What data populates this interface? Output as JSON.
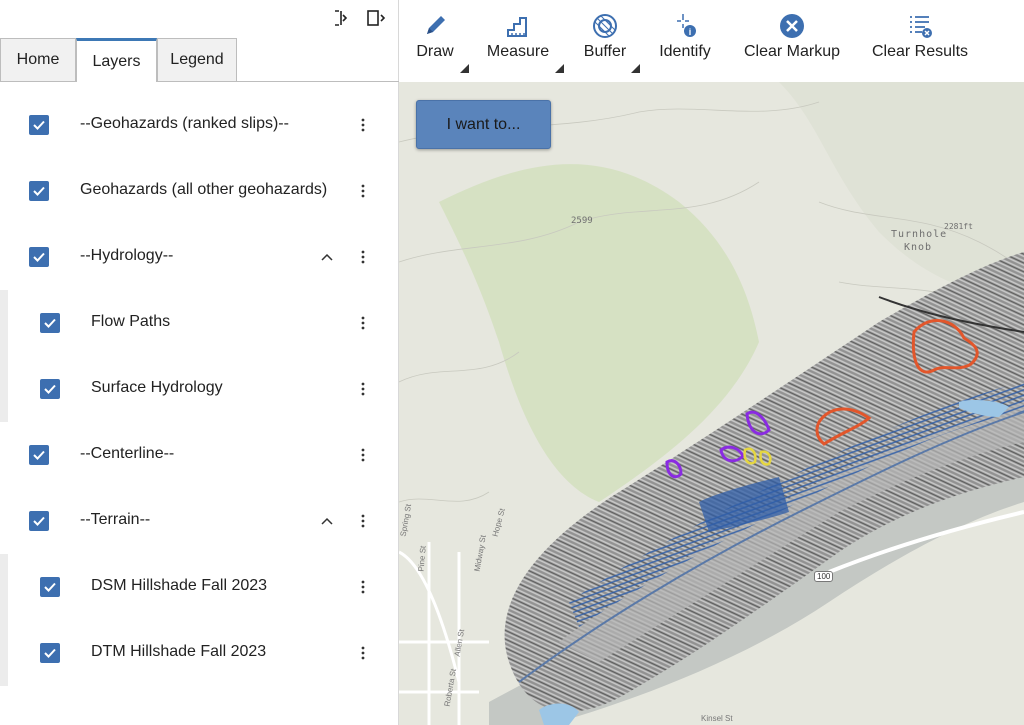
{
  "panel": {
    "tabs": [
      {
        "label": "Home"
      },
      {
        "label": "Layers"
      },
      {
        "label": "Legend"
      }
    ],
    "active_tab": "Layers",
    "layers": [
      {
        "label": "--Geohazards (ranked slips)--",
        "checked": true,
        "expandable": false,
        "child": false
      },
      {
        "label": "Geohazards (all other geohazards)",
        "checked": true,
        "expandable": false,
        "child": false
      },
      {
        "label": "--Hydrology--",
        "checked": true,
        "expandable": true,
        "expanded": true,
        "child": false
      },
      {
        "label": "Flow Paths",
        "checked": true,
        "expandable": false,
        "child": true
      },
      {
        "label": "Surface Hydrology",
        "checked": true,
        "expandable": false,
        "child": true
      },
      {
        "label": "--Centerline--",
        "checked": true,
        "expandable": false,
        "child": false
      },
      {
        "label": "--Terrain--",
        "checked": true,
        "expandable": true,
        "expanded": true,
        "child": false
      },
      {
        "label": "DSM Hillshade Fall 2023",
        "checked": true,
        "expandable": false,
        "child": true
      },
      {
        "label": "DTM Hillshade Fall 2023",
        "checked": true,
        "expandable": false,
        "child": true
      }
    ]
  },
  "toolbar": {
    "tools": [
      {
        "label": "Draw",
        "icon": "pencil-icon",
        "dropdown": true
      },
      {
        "label": "Measure",
        "icon": "ruler-icon",
        "dropdown": true
      },
      {
        "label": "Buffer",
        "icon": "buffer-icon",
        "dropdown": true
      },
      {
        "label": "Identify",
        "icon": "identify-icon",
        "dropdown": false
      },
      {
        "label": "Clear Markup",
        "icon": "clear-markup-icon",
        "dropdown": false
      },
      {
        "label": "Clear Results",
        "icon": "clear-results-icon",
        "dropdown": false
      }
    ]
  },
  "map": {
    "i_want_to_label": "I want to...",
    "labels": {
      "elevation_2599": "2599",
      "turnhole_knob_1": "Turnhole",
      "turnhole_knob_2": "Knob",
      "turnhole_elev": "2281ft",
      "highway_shield": "100",
      "streets": [
        "Spring St",
        "Pine St",
        "Midway St",
        "Hope St",
        "Allen St",
        "Roberta St",
        "Kinsel St"
      ]
    }
  },
  "colors": {
    "accent": "#3d6fb0",
    "active_tab_border": "#3d78b5",
    "button_fill": "#5a84bb",
    "geohazard_orange": "#e2562b",
    "geohazard_purple": "#8a2be2",
    "geohazard_yellow": "#e5d640",
    "flow_paths_blue": "#2f5ea8"
  }
}
